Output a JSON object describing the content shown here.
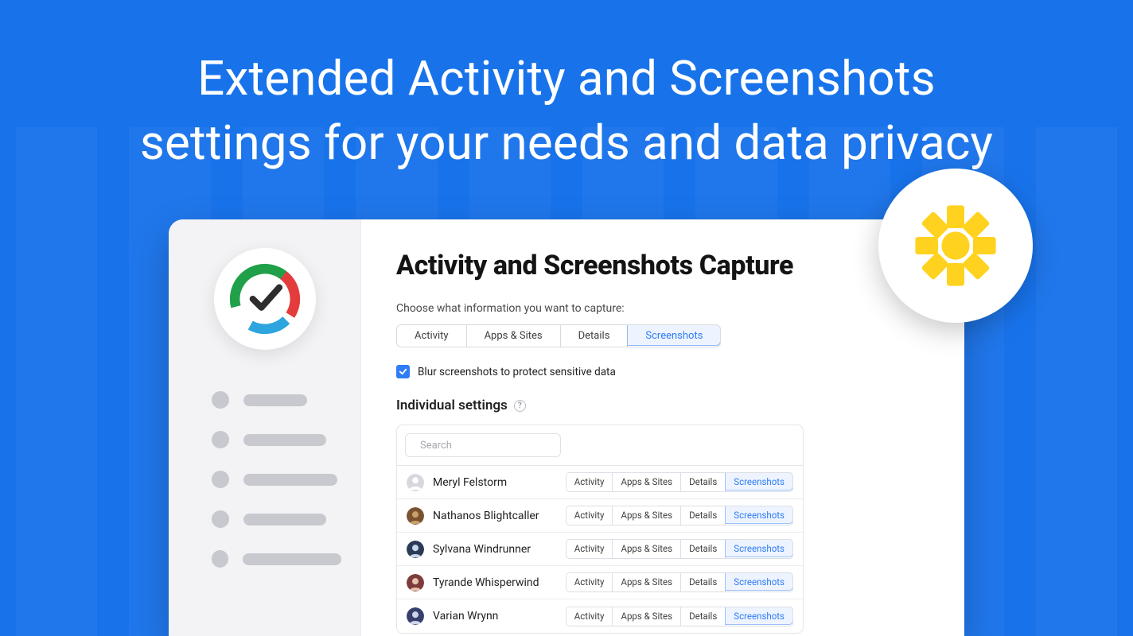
{
  "hero": {
    "line1": "Extended Activity and Screenshots",
    "line2": "settings for your needs and data privacy"
  },
  "main": {
    "title": "Activity and Screenshots Capture",
    "subtitle": "Choose what information you want to capture:",
    "tabs": [
      "Activity",
      "Apps & Sites",
      "Details",
      "Screenshots"
    ],
    "active_tab": "Screenshots",
    "blur": {
      "checked": true,
      "label": "Blur screenshots to protect sensitive data"
    },
    "individual_title": "Individual settings",
    "search_placeholder": "Search",
    "row_tabs": [
      "Activity",
      "Apps & Sites",
      "Details",
      "Screenshots"
    ],
    "row_active": "Screenshots",
    "users": [
      {
        "name": "Meryl Felstorm",
        "avatar_bg": "#d6d8de",
        "avatar_fg": "#ffffff",
        "preset": true
      },
      {
        "name": "Nathanos Blightcaller",
        "avatar_bg": "#7a5230",
        "avatar_fg": "#c9a06a"
      },
      {
        "name": "Sylvana Windrunner",
        "avatar_bg": "#2b3a55",
        "avatar_fg": "#c8d6ef"
      },
      {
        "name": "Tyrande Whisperwind",
        "avatar_bg": "#7d3b3b",
        "avatar_fg": "#e7c3b0"
      },
      {
        "name": "Varian Wrynn",
        "avatar_bg": "#37406b",
        "avatar_fg": "#d0d4ef"
      }
    ]
  },
  "sidebar": {
    "nav_widths": [
      80,
      104,
      118,
      104,
      128
    ]
  },
  "colors": {
    "accent": "#2e7cf6",
    "burst": "#ffd21f"
  }
}
